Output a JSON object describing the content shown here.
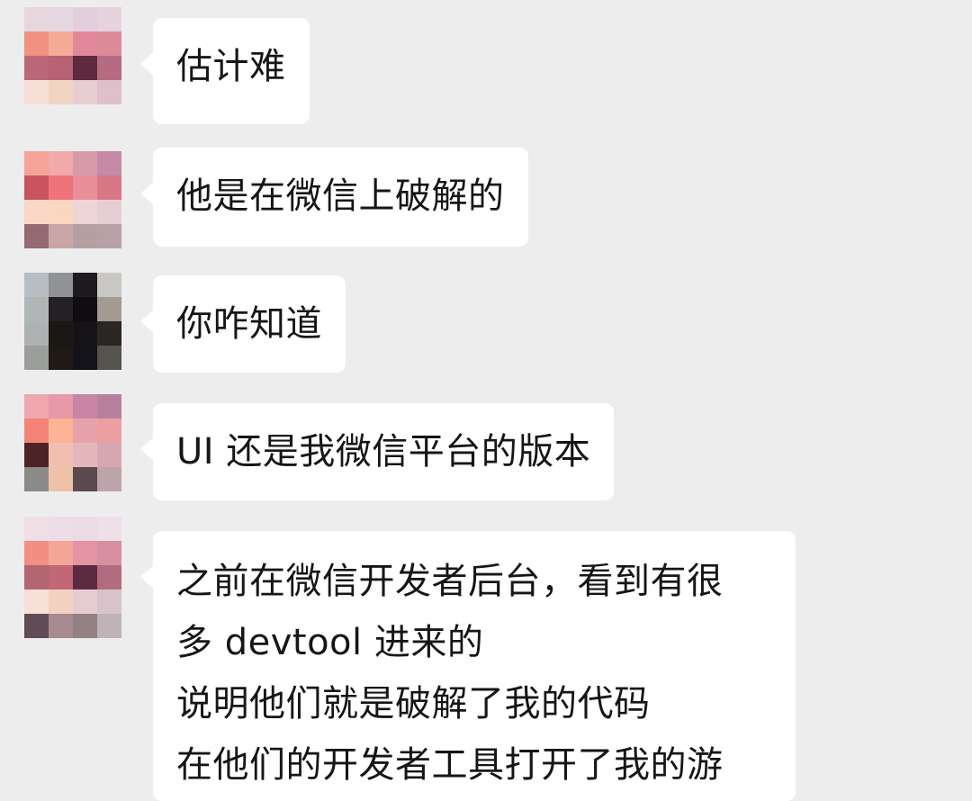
{
  "theme": {
    "background": "#ededed",
    "bubble_color": "#ffffff",
    "text_color": "#161616"
  },
  "messages": [
    {
      "avatar": {
        "icon": "pixelated-avatar-icon",
        "colors": [
          "#e8d6de",
          "#e6d7e0",
          "#e3cfdc",
          "#e6d3dd",
          "#f0927f",
          "#f3ab98",
          "#e1899b",
          "#dc8a98",
          "#bb6777",
          "#b86275",
          "#5e2a3e",
          "#b56b82",
          "#f8dfd6",
          "#f2d4c3",
          "#e8cdd3",
          "#dfc0ca"
        ]
      },
      "lines": [
        "估计难"
      ]
    },
    {
      "avatar": {
        "icon": "pixelated-avatar-icon",
        "colors": [
          "#f6a397",
          "#f1a9a9",
          "#d79aa9",
          "#c58aa6",
          "#c95460",
          "#ee7479",
          "#e88f99",
          "#d87684",
          "#fbd7c7",
          "#fad8bf",
          "#eed4d7",
          "#e5cfd4",
          "#966a72",
          "#c9a5a6",
          "#b4a0a2",
          "#b8a1a6"
        ]
      },
      "lines": [
        "他是在微信上破解的"
      ]
    },
    {
      "avatar": {
        "icon": "pixelated-avatar-icon",
        "colors": [
          "#b8bdc2",
          "#8f9396",
          "#1d1b1f",
          "#c9c8c4",
          "#b2b5b6",
          "#232026",
          "#0f0d12",
          "#a39a92",
          "#aeb2b2",
          "#1b1713",
          "#151317",
          "#2a2624",
          "#9c9e9c",
          "#1f1a16",
          "#15131a",
          "#55554d"
        ]
      },
      "lines": [
        "你咋知道"
      ]
    },
    {
      "avatar": {
        "icon": "pixelated-avatar-icon",
        "colors": [
          "#f0a7ae",
          "#e69aa8",
          "#c985a6",
          "#b8809f",
          "#f38476",
          "#fbb495",
          "#e8a2ab",
          "#ec9ea0",
          "#4c2425",
          "#f1c0b1",
          "#e4b7bd",
          "#d6a7af",
          "#8c8989",
          "#eec2a7",
          "#5a4a4e",
          "#bda4ab"
        ]
      },
      "lines": [
        "UI 还是我微信平台的版本"
      ]
    },
    {
      "avatar": {
        "icon": "pixelated-avatar-icon",
        "colors": [
          "#f0e0e6",
          "#eddde6",
          "#eadbe4",
          "#efdfe9",
          "#f38e85",
          "#f4a696",
          "#e393a2",
          "#d88f9f",
          "#b36672",
          "#c16776",
          "#5c2a3e",
          "#b36b80",
          "#f8e0d6",
          "#f3d2c2",
          "#e6cbd3",
          "#d8c3cb",
          "#5f4c56",
          "#a78a91",
          "#958083",
          "#bfb2b9"
        ]
      },
      "lines": [
        "之前在微信开发者后台，看到有很",
        "多 devtool 进来的",
        "说明他们就是破解了我的代码",
        "在他们的开发者工具打开了我的游"
      ]
    }
  ]
}
